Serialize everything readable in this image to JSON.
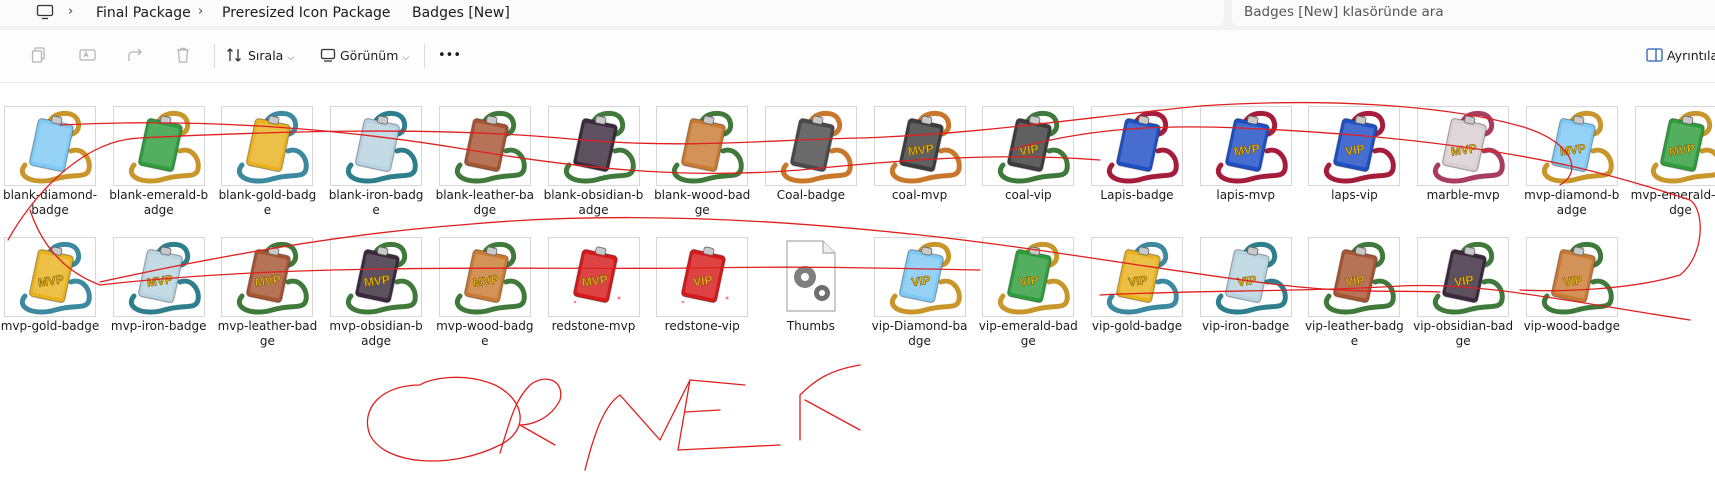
{
  "breadcrumb": [
    "Final Package",
    "Preresized Icon Package",
    "Badges [New]"
  ],
  "search": {
    "placeholder": "Badges [New] klasöründe ara"
  },
  "toolbar": {
    "sort_label": "Sırala",
    "view_label": "Görünüm",
    "more_label": "•••",
    "details_label": "Ayrıntılar"
  },
  "files": [
    {
      "name": "blank-diamond-badge",
      "material": "#7ec8f4",
      "string": "#c9962b",
      "mark": ""
    },
    {
      "name": "blank-emerald-badge",
      "material": "#2f9d3c",
      "string": "#c9962b",
      "mark": ""
    },
    {
      "name": "blank-gold-badge",
      "material": "#e8b21e",
      "string": "#3d8aa0",
      "mark": ""
    },
    {
      "name": "blank-iron-badge",
      "material": "#b7d2e0",
      "string": "#2e7f8e",
      "mark": ""
    },
    {
      "name": "blank-leather-badge",
      "material": "#a65532",
      "string": "#3f7a3a",
      "mark": ""
    },
    {
      "name": "blank-obsidian-badge",
      "material": "#3a2a3c",
      "string": "#3f7a3a",
      "mark": ""
    },
    {
      "name": "blank-wood-badge",
      "material": "#c87a34",
      "string": "#3f7a3a",
      "mark": ""
    },
    {
      "name": "Coal-badge",
      "material": "#4a4a4a",
      "string": "#c9772b",
      "mark": ""
    },
    {
      "name": "coal-mvp",
      "material": "#3d3d3d",
      "string": "#c9772b",
      "mark": "MVP"
    },
    {
      "name": "coal-vip",
      "material": "#3d3d3d",
      "string": "#3f7a3a",
      "mark": "VIP"
    },
    {
      "name": "Lapis-badge",
      "material": "#1f4fc4",
      "string": "#a51d3a",
      "mark": ""
    },
    {
      "name": "lapis-mvp",
      "material": "#1f4fc4",
      "string": "#a51d3a",
      "mark": "MVP"
    },
    {
      "name": "laps-vip",
      "material": "#1f4fc4",
      "string": "#a51d3a",
      "mark": "VIP"
    },
    {
      "name": "marble-mvp",
      "material": "#d9cfd2",
      "string": "#a83d5e",
      "mark": "MVP"
    },
    {
      "name": "mvp-diamond-badge",
      "material": "#7ec8f4",
      "string": "#c9962b",
      "mark": "MVP"
    },
    {
      "name": "mvp-emerald-badge",
      "material": "#2f9d3c",
      "string": "#c9962b",
      "mark": "MVP"
    },
    {
      "name": "mvp-gold-badge",
      "material": "#e8b21e",
      "string": "#3d8aa0",
      "mark": "MVP"
    },
    {
      "name": "mvp-iron-badge",
      "material": "#b7d2e0",
      "string": "#2e7f8e",
      "mark": "MVP"
    },
    {
      "name": "mvp-leather-badge",
      "material": "#a65532",
      "string": "#3f7a3a",
      "mark": "MVP"
    },
    {
      "name": "mvp-obsidian-badge",
      "material": "#3a2a3c",
      "string": "#3f7a3a",
      "mark": "MVP"
    },
    {
      "name": "mvp-wood-badge",
      "material": "#c87a34",
      "string": "#3f7a3a",
      "mark": "MVP"
    },
    {
      "name": "redstone-mvp",
      "material": "#d61a1a",
      "string": "",
      "mark": "MVP"
    },
    {
      "name": "redstone-vip",
      "material": "#d61a1a",
      "string": "",
      "mark": "VIP"
    },
    {
      "name": "Thumbs",
      "material": "",
      "string": "",
      "mark": "",
      "icon": "settings-file-icon"
    },
    {
      "name": "vip-Diamond-badge",
      "material": "#7ec8f4",
      "string": "#c9962b",
      "mark": "VIP"
    },
    {
      "name": "vip-emerald-badge",
      "material": "#2f9d3c",
      "string": "#c9962b",
      "mark": "VIP"
    },
    {
      "name": "vip-gold-badge",
      "material": "#e8b21e",
      "string": "#3d8aa0",
      "mark": "VIP"
    },
    {
      "name": "vip-iron-badge",
      "material": "#b7d2e0",
      "string": "#2e7f8e",
      "mark": "VIP"
    },
    {
      "name": "vip-leather-badge",
      "material": "#a65532",
      "string": "#3f7a3a",
      "mark": "VIP"
    },
    {
      "name": "vip-obsidian-badge",
      "material": "#3a2a3c",
      "string": "#3f7a3a",
      "mark": "VIP"
    },
    {
      "name": "vip-wood-badge",
      "material": "#c87a34",
      "string": "#3f7a3a",
      "mark": "VIP"
    }
  ],
  "annotation": {
    "text": "ORNEK",
    "color": "#e02020"
  }
}
